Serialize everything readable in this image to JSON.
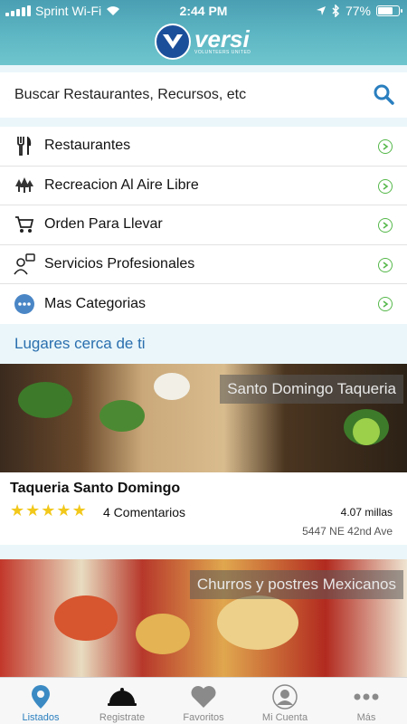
{
  "status_bar": {
    "carrier": "Sprint Wi-Fi",
    "time": "2:44 PM",
    "battery": "77%",
    "battery_level": 0.77
  },
  "brand": {
    "name": "versi",
    "tagline": "VOLUNTEERS UNITED"
  },
  "search": {
    "placeholder": "Buscar Restaurantes, Recursos, etc"
  },
  "categories": [
    {
      "label": "Restaurantes",
      "icon": "fork-knife-icon"
    },
    {
      "label": "Recreacion Al Aire Libre",
      "icon": "trees-icon"
    },
    {
      "label": "Orden Para Llevar",
      "icon": "cart-icon"
    },
    {
      "label": "Servicios Profesionales",
      "icon": "person-chat-icon"
    },
    {
      "label": "Mas Categorias",
      "icon": "more-dots-icon"
    }
  ],
  "nearby_title": "Lugares cerca de ti",
  "places": [
    {
      "photo_caption": "Santo Domingo Taqueria",
      "name": "Taqueria Santo Domingo",
      "rating": 5,
      "reviews": "4 Comentarios",
      "distance": "4.07 millas",
      "address": "5447 NE 42nd Ave"
    },
    {
      "photo_caption": "Churros y postres Mexicanos"
    }
  ],
  "tabs": [
    {
      "label": "Listados",
      "icon": "location-pin-icon",
      "active": true
    },
    {
      "label": "Registrate",
      "icon": "cloche-icon",
      "active": false
    },
    {
      "label": "Favoritos",
      "icon": "heart-icon",
      "active": false
    },
    {
      "label": "Mi Cuenta",
      "icon": "user-icon",
      "active": false
    },
    {
      "label": "Más",
      "icon": "more-icon",
      "active": false
    }
  ],
  "colors": {
    "header_gradient_top": "#4a9fb2",
    "accent_blue": "#2a7fbf",
    "chevron_green": "#55b84a",
    "star_yellow": "#f2c81b"
  }
}
